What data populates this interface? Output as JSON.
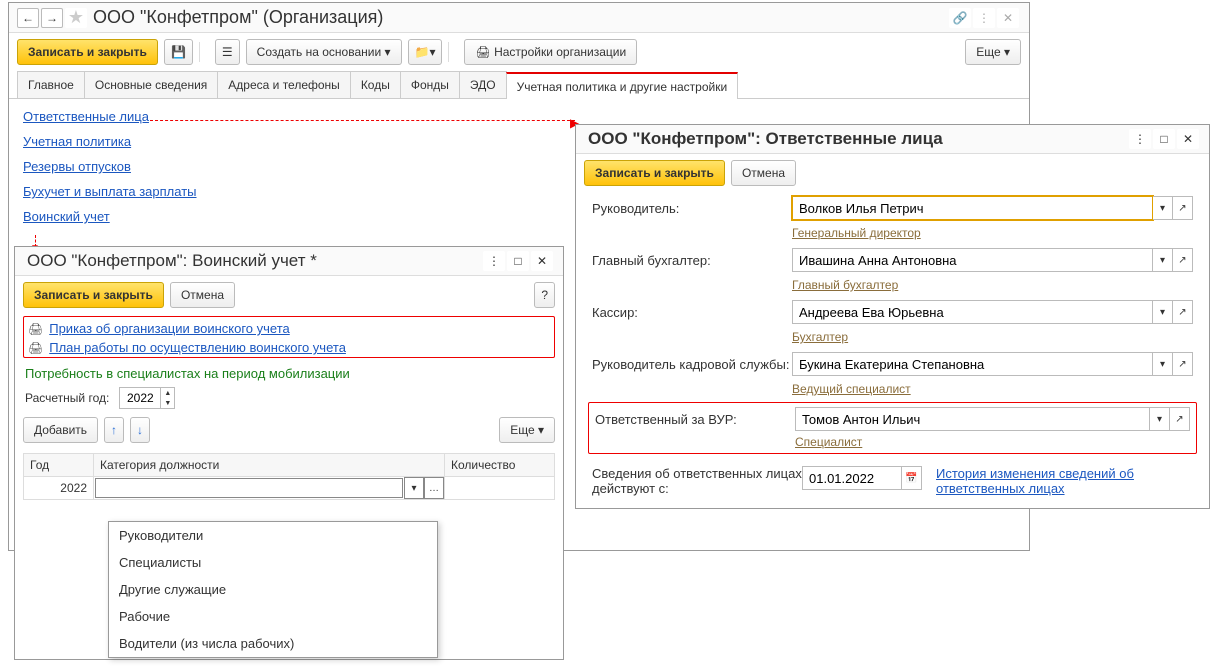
{
  "main": {
    "title": "ООО \"Конфетпром\" (Организация)",
    "toolbar": {
      "save_close": "Записать и закрыть",
      "create_based": "Создать на основании",
      "org_settings": "Настройки организации",
      "more": "Еще"
    },
    "tabs": [
      "Главное",
      "Основные сведения",
      "Адреса и телефоны",
      "Коды",
      "Фонды",
      "ЭДО",
      "Учетная политика и другие настройки"
    ],
    "active_tab": 6,
    "links": [
      "Ответственные лица",
      "Учетная политика",
      "Резервы отпусков",
      "Бухучет и выплата зарплаты",
      "Воинский учет"
    ]
  },
  "voin": {
    "title": "ООО \"Конфетпром\": Воинский учет *",
    "save_close": "Записать и закрыть",
    "cancel": "Отмена",
    "help": "?",
    "prikaz": "Приказ об организации воинского учета",
    "plan": "План работы по осуществлению воинского учета",
    "potreb": "Потребность в специалистах на период мобилизации",
    "year_label": "Расчетный год:",
    "year": "2022",
    "add": "Добавить",
    "more": "Еще",
    "cols": [
      "Год",
      "Категория должности",
      "Количество"
    ],
    "row_year": "2022",
    "row_cat": "",
    "dropdown": [
      "Руководители",
      "Специалисты",
      "Другие служащие",
      "Рабочие",
      "Водители (из числа рабочих)"
    ]
  },
  "resp": {
    "title": "ООО \"Конфетпром\": Ответственные лица",
    "save_close": "Записать и закрыть",
    "cancel": "Отмена",
    "fields": {
      "ruk": {
        "label": "Руководитель:",
        "value": "Волков Илья Петрич",
        "pos": "Генеральный директор"
      },
      "glbuh": {
        "label": "Главный бухгалтер:",
        "value": "Ивашина Анна Антоновна",
        "pos": "Главный бухгалтер"
      },
      "kassir": {
        "label": "Кассир:",
        "value": "Андреева Ева Юрьевна",
        "pos": "Бухгалтер"
      },
      "kadr": {
        "label": "Руководитель кадровой службы:",
        "value": "Букина Екатерина Степановна",
        "pos": "Ведущий специалист"
      },
      "vur": {
        "label": "Ответственный за ВУР:",
        "value": "Томов Антон Ильич",
        "pos": "Специалист"
      }
    },
    "effective_label": "Сведения об ответственных лицах действуют с:",
    "effective_date": "01.01.2022",
    "history_link": "История изменения сведений об ответственных лицах"
  }
}
